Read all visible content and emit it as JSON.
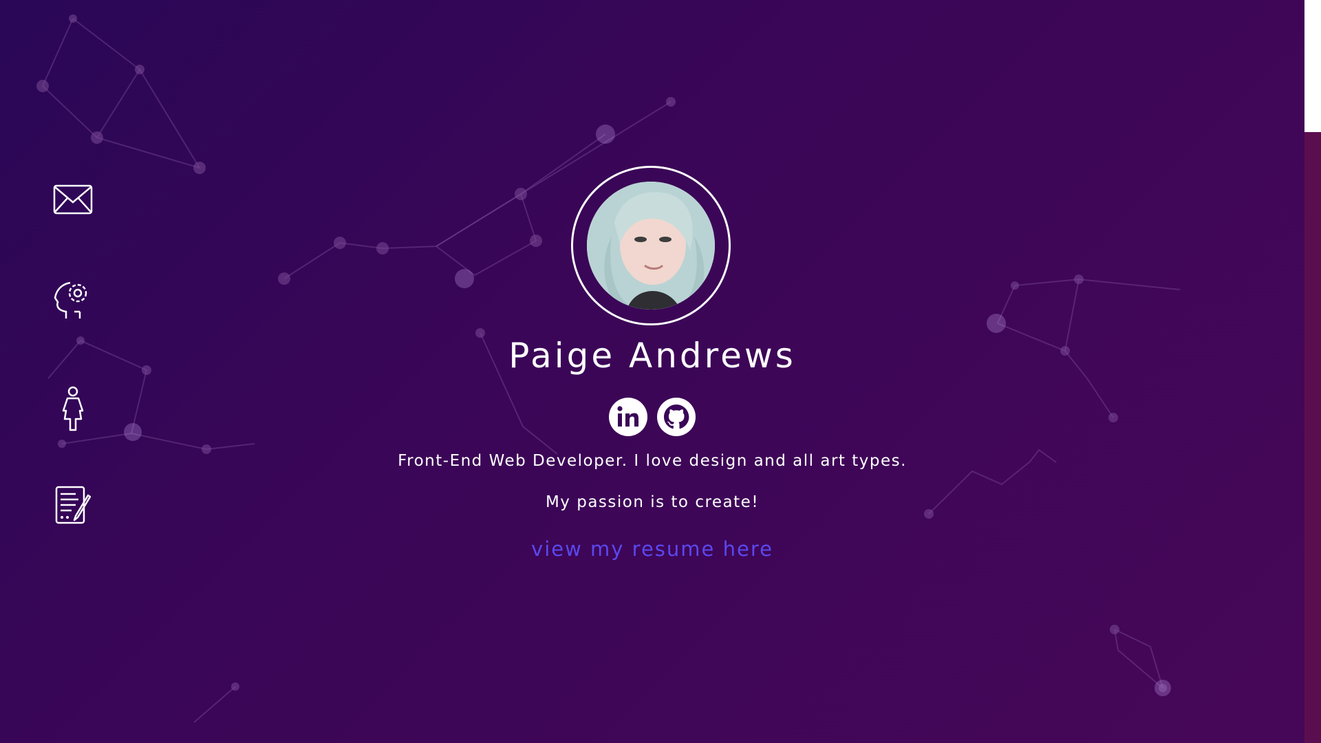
{
  "page": {
    "background_start": "#2a0757",
    "background_end": "#470758",
    "accent_link": "#5a48ef"
  },
  "sidebar": {
    "items": [
      {
        "icon": "envelope-icon",
        "name": "contact"
      },
      {
        "icon": "head-gear-icon",
        "name": "skills"
      },
      {
        "icon": "person-icon",
        "name": "about"
      },
      {
        "icon": "document-icon",
        "name": "resume"
      }
    ]
  },
  "profile": {
    "name": "Paige Andrews",
    "tagline": "Front-End Web Developer. I love design and all art types.",
    "passion": "My passion is to create!",
    "resume_link": "view my resume here"
  },
  "socials": [
    {
      "icon": "linkedin-icon"
    },
    {
      "icon": "github-icon"
    }
  ]
}
